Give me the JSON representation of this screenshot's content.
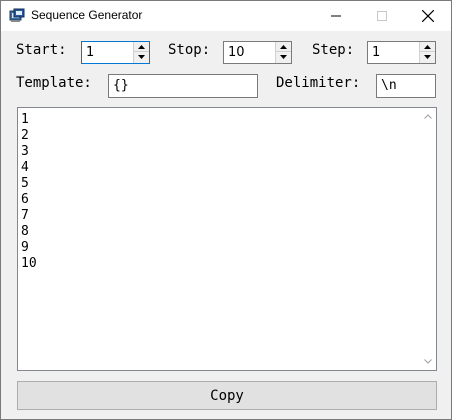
{
  "window": {
    "title": "Sequence Generator"
  },
  "titlebar": {
    "minimize_icon": "minimize-icon",
    "maximize_icon": "maximize-icon",
    "close_icon": "close-icon"
  },
  "form": {
    "start_label": "Start:",
    "start_value": "1",
    "stop_label": "Stop:",
    "stop_value": "10",
    "step_label": "Step:",
    "step_value": "1",
    "template_label": "Template:",
    "template_value": "{}",
    "delimiter_label": "Delimiter:",
    "delimiter_value": "\\n"
  },
  "output": {
    "lines": [
      "1",
      "2",
      "3",
      "4",
      "5",
      "6",
      "7",
      "8",
      "9",
      "10"
    ]
  },
  "actions": {
    "copy_label": "Copy"
  },
  "colors": {
    "focus_border": "#0078d7",
    "background": "#f0f0f0"
  }
}
